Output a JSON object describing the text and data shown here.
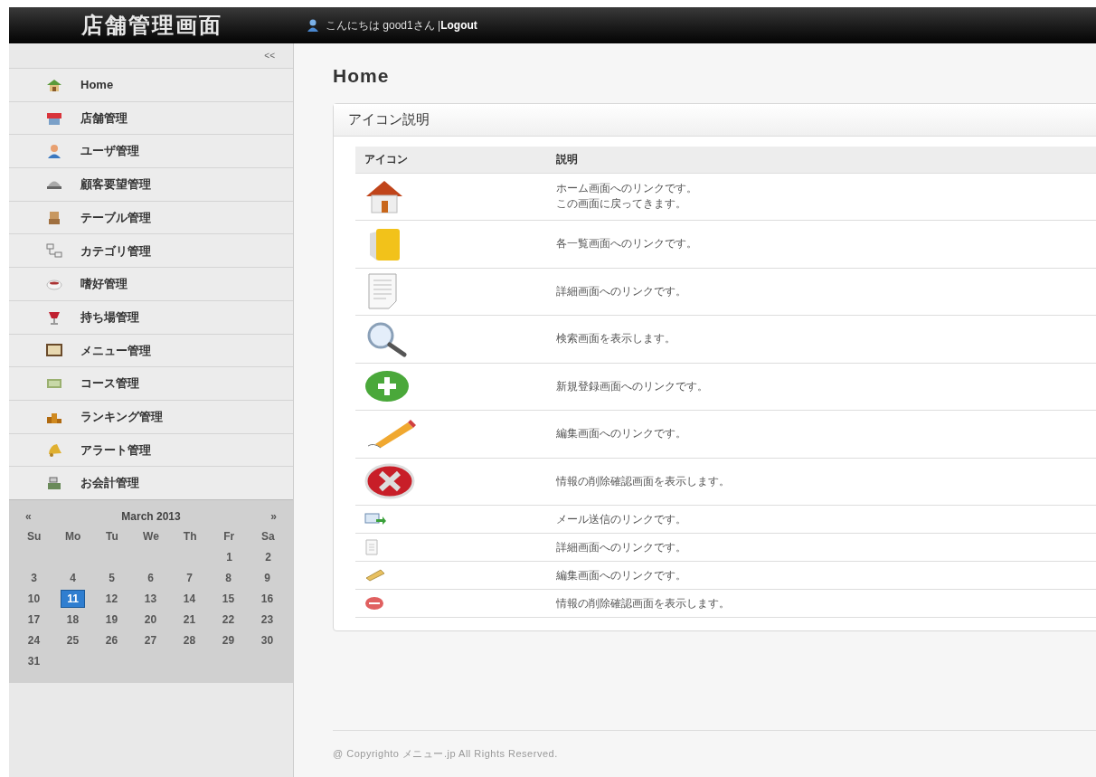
{
  "header": {
    "title": "店舗管理画面",
    "greeting": "こんにちは good1さん |",
    "logout": "Logout"
  },
  "sidebar": {
    "collapse": "<<",
    "items": [
      {
        "label": "Home",
        "kind": "home"
      },
      {
        "label": "店舗管理",
        "kind": "shop"
      },
      {
        "label": "ユーザ管理",
        "kind": "user"
      },
      {
        "label": "顧客要望管理",
        "kind": "cloche"
      },
      {
        "label": "テーブル管理",
        "kind": "chair"
      },
      {
        "label": "カテゴリ管理",
        "kind": "category"
      },
      {
        "label": "嗜好管理",
        "kind": "cup"
      },
      {
        "label": "持ち場管理",
        "kind": "glass"
      },
      {
        "label": "メニュー管理",
        "kind": "board"
      },
      {
        "label": "コース管理",
        "kind": "course"
      },
      {
        "label": "ランキング管理",
        "kind": "podium"
      },
      {
        "label": "アラート管理",
        "kind": "bell"
      },
      {
        "label": "お会計管理",
        "kind": "register"
      }
    ]
  },
  "calendar": {
    "prev": "«",
    "title": "March 2013",
    "next": "»",
    "weekdays": [
      "Su",
      "Mo",
      "Tu",
      "We",
      "Th",
      "Fr",
      "Sa"
    ],
    "weeks": [
      {
        "kind": "leading",
        "days": [
          {
            "day": "1",
            "selected": false
          },
          {
            "day": "2",
            "selected": false
          }
        ]
      },
      {
        "kind": "full",
        "days": [
          {
            "day": "3",
            "selected": false
          },
          {
            "day": "4",
            "selected": false
          },
          {
            "day": "5",
            "selected": false
          },
          {
            "day": "6",
            "selected": false
          },
          {
            "day": "7",
            "selected": false
          },
          {
            "day": "8",
            "selected": false
          },
          {
            "day": "9",
            "selected": false
          }
        ]
      },
      {
        "kind": "full",
        "days": [
          {
            "day": "10",
            "selected": false
          },
          {
            "day": "11",
            "selected": true
          },
          {
            "day": "12",
            "selected": false
          },
          {
            "day": "13",
            "selected": false
          },
          {
            "day": "14",
            "selected": false
          },
          {
            "day": "15",
            "selected": false
          },
          {
            "day": "16",
            "selected": false
          }
        ]
      },
      {
        "kind": "full",
        "days": [
          {
            "day": "17",
            "selected": false
          },
          {
            "day": "18",
            "selected": false
          },
          {
            "day": "19",
            "selected": false
          },
          {
            "day": "20",
            "selected": false
          },
          {
            "day": "21",
            "selected": false
          },
          {
            "day": "22",
            "selected": false
          },
          {
            "day": "23",
            "selected": false
          }
        ]
      },
      {
        "kind": "full",
        "days": [
          {
            "day": "24",
            "selected": false
          },
          {
            "day": "25",
            "selected": false
          },
          {
            "day": "26",
            "selected": false
          },
          {
            "day": "27",
            "selected": false
          },
          {
            "day": "28",
            "selected": false
          },
          {
            "day": "29",
            "selected": false
          },
          {
            "day": "30",
            "selected": false
          }
        ]
      },
      {
        "kind": "trailing",
        "days": [
          {
            "day": "31",
            "selected": false
          }
        ]
      }
    ]
  },
  "page_title": "Home",
  "panel": {
    "title": "アイコン説明",
    "table": {
      "columns": [
        "アイコン",
        "説明"
      ],
      "rows": [
        {
          "kind": "home",
          "lines": [
            "ホーム画面へのリンクです。",
            "この画面に戻ってきます。"
          ]
        },
        {
          "kind": "folder",
          "lines": [
            "各一覧画面へのリンクです。"
          ]
        },
        {
          "kind": "document",
          "lines": [
            "詳細画面へのリンクです。"
          ]
        },
        {
          "kind": "search",
          "lines": [
            "検索画面を表示します。"
          ]
        },
        {
          "kind": "add",
          "lines": [
            "新規登録画面へのリンクです。"
          ]
        },
        {
          "kind": "edit",
          "lines": [
            "編集画面へのリンクです。"
          ]
        },
        {
          "kind": "delete",
          "lines": [
            "情報の削除確認画面を表示します。"
          ]
        },
        {
          "kind": "mail-small",
          "lines": [
            "メール送信のリンクです。"
          ]
        },
        {
          "kind": "document-small",
          "lines": [
            "詳細画面へのリンクです。"
          ]
        },
        {
          "kind": "edit-small",
          "lines": [
            "編集画面へのリンクです。"
          ]
        },
        {
          "kind": "delete-small",
          "lines": [
            "情報の削除確認画面を表示します。"
          ]
        }
      ]
    }
  },
  "footer": "@ Copyrighto メニュー.jp All Rights Reserved."
}
